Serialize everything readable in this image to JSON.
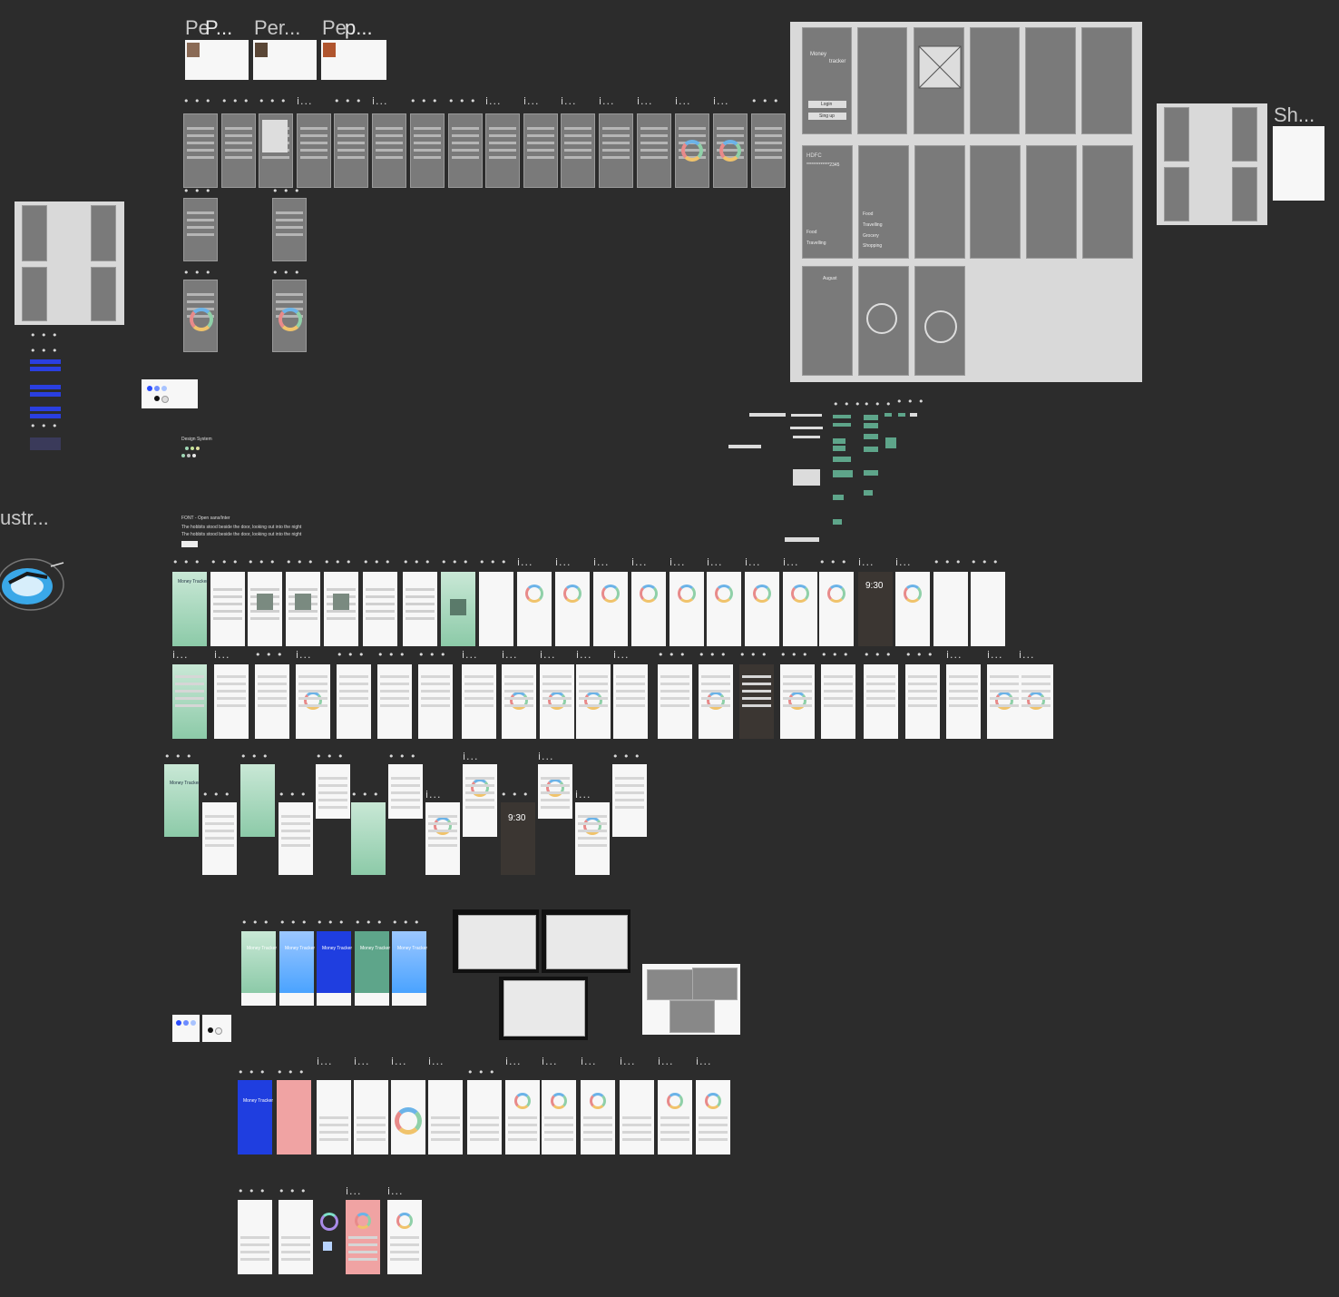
{
  "section_labels": {
    "persona_1": "Pe",
    "persona_1_overlap": "P...",
    "persona_2": "Per...",
    "persona_3": "Pe",
    "persona_3_overlap": "p...",
    "illustration": "ustr...",
    "share": "Sh..."
  },
  "frame_labels": {
    "dots": "• • •",
    "icon_dots": "i..."
  },
  "wireframe": {
    "app_title_line1": "Money",
    "app_title_line2": "tracker",
    "login": "Login",
    "signup": "Sing up",
    "balance": "HDFC",
    "balance_number": "*************2345",
    "food": "Food",
    "travelling": "Travelling",
    "grocery": "Grocery",
    "shopping": "Shopping",
    "august": "August"
  },
  "design_system": {
    "title": "Design System",
    "font_label": "FONT - Open sans/Inter",
    "sample_1": "The hobbits stood beside the door, looking out into the night",
    "sample_2": "The hobbits stood beside the door, looking out into the night"
  },
  "hifi": {
    "money_tracker": "Money Tracker",
    "clock": "9:30"
  },
  "colors": {
    "canvas": "#2c2c2c",
    "wire": "#7a7a7a",
    "accent_green": "#5ea58a",
    "accent_blue": "#1f3ee0",
    "pink": "#f0a3a3"
  }
}
